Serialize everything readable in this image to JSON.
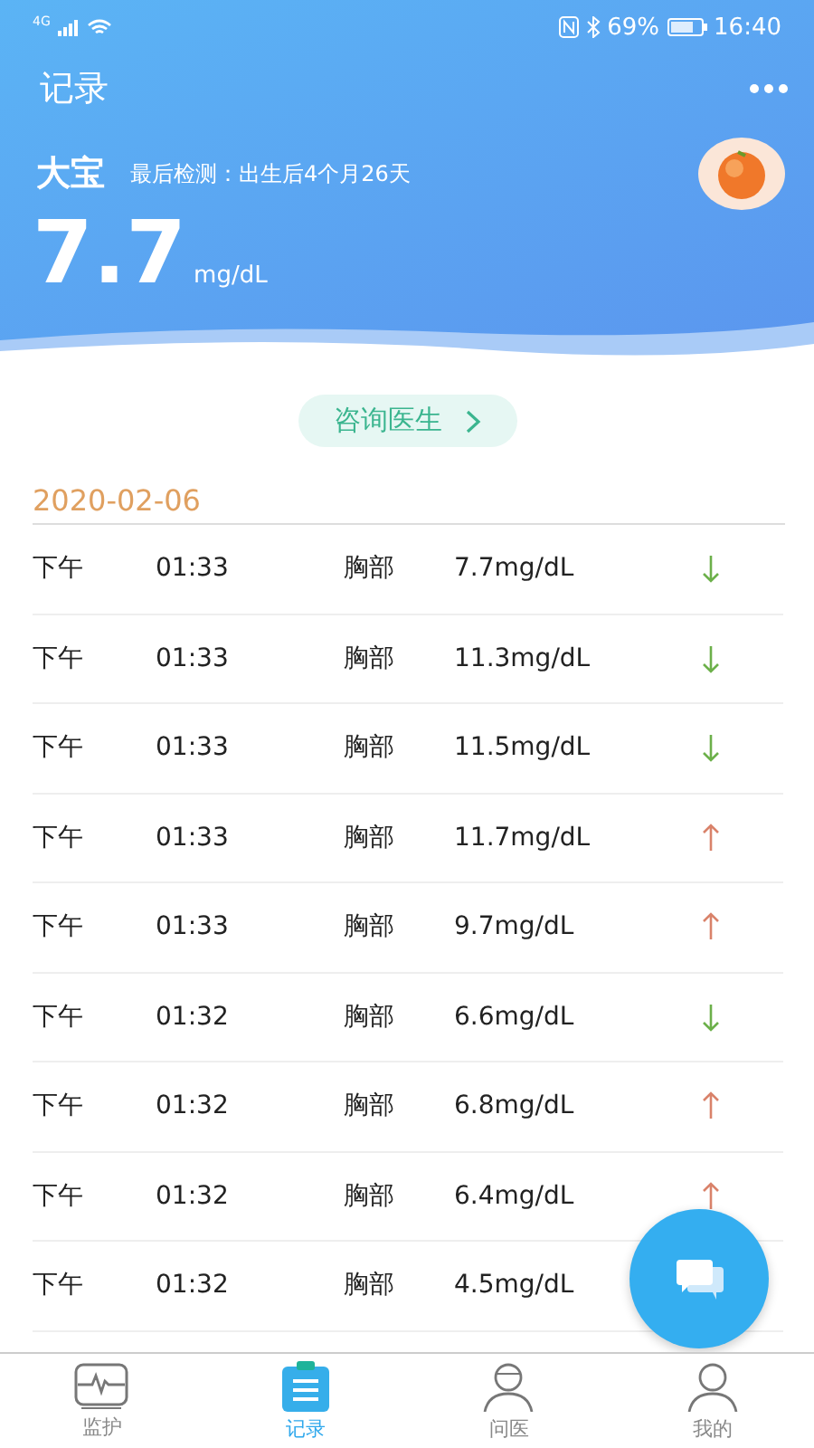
{
  "status_bar": {
    "network": "4G",
    "battery": "69%",
    "time": "16:40"
  },
  "header": {
    "title": "记录",
    "name": "大宝",
    "last_check": "最后检测：出生后4个月26天",
    "value": "7.7",
    "unit": "mg/dL"
  },
  "consult_button": {
    "label": "咨询医生"
  },
  "date": "2020-02-06",
  "records": [
    {
      "period": "下午",
      "time": "01:33",
      "site": "胸部",
      "reading": "7.7mg/dL",
      "kind": "falling"
    },
    {
      "period": "下午",
      "time": "01:33",
      "site": "胸部",
      "reading": "11.3mg/dL",
      "kind": "falling"
    },
    {
      "period": "下午",
      "time": "01:33",
      "site": "胸部",
      "reading": "11.5mg/dL",
      "kind": "falling"
    },
    {
      "period": "下午",
      "time": "01:33",
      "site": "胸部",
      "reading": "11.7mg/dL",
      "kind": "rising"
    },
    {
      "period": "下午",
      "time": "01:33",
      "site": "胸部",
      "reading": "9.7mg/dL",
      "kind": "rising"
    },
    {
      "period": "下午",
      "time": "01:32",
      "site": "胸部",
      "reading": "6.6mg/dL",
      "kind": "falling"
    },
    {
      "period": "下午",
      "time": "01:32",
      "site": "胸部",
      "reading": "6.8mg/dL",
      "kind": "rising"
    },
    {
      "period": "下午",
      "time": "01:32",
      "site": "胸部",
      "reading": "6.4mg/dL",
      "kind": "rising"
    },
    {
      "period": "下午",
      "time": "01:32",
      "site": "胸部",
      "reading": "4.5mg/dL"
    }
  ],
  "tabs": [
    {
      "label": "监护",
      "kind": "monitor",
      "selected": false
    },
    {
      "label": "记录",
      "kind": "record",
      "selected": true
    },
    {
      "label": "问医",
      "kind": "doctor",
      "selected": false
    },
    {
      "label": "我的",
      "kind": "user",
      "selected": false
    }
  ]
}
